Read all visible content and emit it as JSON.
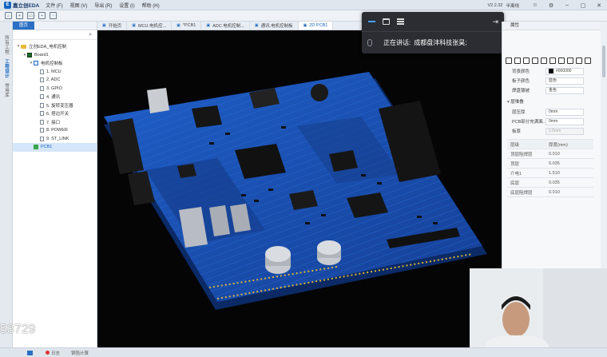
{
  "app": {
    "name": "嘉立创EDA",
    "menu": [
      "文件 (F)",
      "视图 (V)",
      "导出 (R)",
      "设置 (I)",
      "帮助 (H)"
    ],
    "version": "V2.2.32",
    "mode": "半离线"
  },
  "left_rail": [
    "所有工程",
    "工程设计",
    "常用库"
  ],
  "panel": {
    "tabs": [
      "图页"
    ],
    "search_placeholder": "",
    "tree": [
      {
        "label": "立创EDA_电机控制",
        "type": "folder",
        "indent": 0
      },
      {
        "label": "Board1",
        "type": "board",
        "indent": 1
      },
      {
        "label": "电机控制板",
        "type": "sch",
        "indent": 2
      },
      {
        "label": "1. MCU",
        "type": "page",
        "indent": 3
      },
      {
        "label": "2. ADC",
        "type": "page",
        "indent": 3
      },
      {
        "label": "3. GPIO",
        "type": "page",
        "indent": 3
      },
      {
        "label": "4. 通讯",
        "type": "page",
        "indent": 3
      },
      {
        "label": "5. 旋转变压器",
        "type": "page",
        "indent": 3
      },
      {
        "label": "6. 搭边开关",
        "type": "page",
        "indent": 3
      },
      {
        "label": "7. 接口",
        "type": "page",
        "indent": 3
      },
      {
        "label": "8. POWER",
        "type": "page",
        "indent": 3
      },
      {
        "label": "9. ST_LINK",
        "type": "page",
        "indent": 3
      },
      {
        "label": "PCB1",
        "type": "pcb",
        "indent": 2
      }
    ]
  },
  "doc_tabs": [
    {
      "label": "开始页",
      "active": false
    },
    {
      "label": "MCU.电机控...",
      "active": false
    },
    {
      "label": "*PCB1",
      "active": false
    },
    {
      "label": "ADC.电机控制...",
      "active": false
    },
    {
      "label": "通讯.电机控制板",
      "active": false
    },
    {
      "label": "2D  PCB1",
      "active": true
    }
  ],
  "meeting": {
    "speaking_label": "正在讲话:",
    "speaker": "成都盘沣科技张昊;"
  },
  "props": {
    "header": "属性",
    "rows": [
      {
        "label": "背景颜色",
        "value": "#000000",
        "swatch": true
      },
      {
        "label": "板子颜色",
        "value": "蓝色"
      },
      {
        "label": "焊盘镀被",
        "value": "金色"
      }
    ],
    "section": "层堆叠",
    "rows2": [
      {
        "label": "层压厚",
        "value": "0mm",
        "disabled": false
      },
      {
        "label": "PCB部分充满面...",
        "value": "0mm",
        "disabled": false
      },
      {
        "label": "板厚",
        "value": "1.6mm",
        "disabled": true
      }
    ],
    "stack_header": [
      "层级",
      "厚度(mm)"
    ],
    "stack": [
      [
        "顶层阻焊层",
        "0.010"
      ],
      [
        "顶层",
        "0.035"
      ],
      [
        "介电1",
        "1.510"
      ],
      [
        "底层",
        "0.035"
      ],
      [
        "底层阻焊层",
        "0.010"
      ]
    ]
  },
  "status": {
    "items": [
      "日志",
      "铜箔计算"
    ]
  },
  "overlay_number": "53729",
  "colors": {
    "accent": "#1565c0",
    "pcb_blue": "#1a4fb0",
    "canvas": "#050505"
  }
}
